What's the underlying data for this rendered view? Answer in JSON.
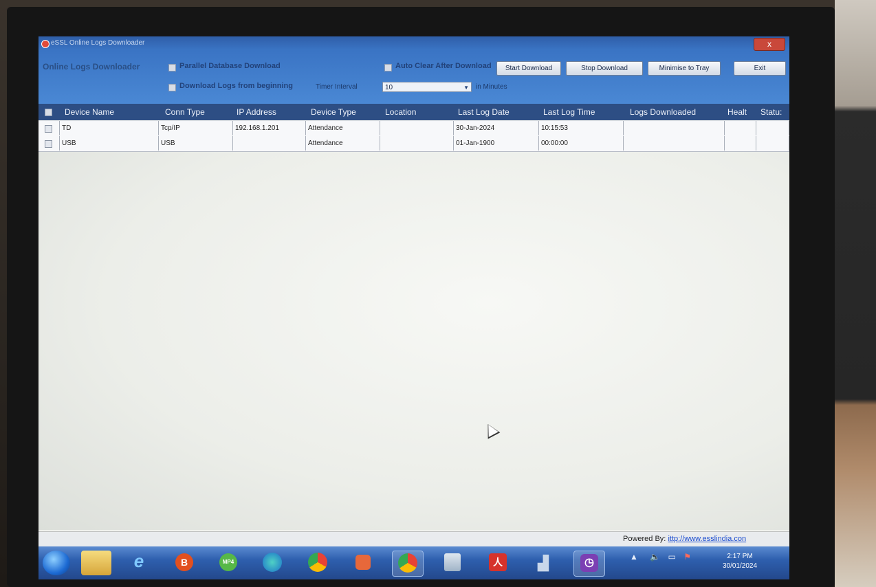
{
  "window": {
    "title": "eSSL Online Logs Downloader",
    "close_label": "x"
  },
  "toolbar": {
    "app_name": "Online Logs Downloader",
    "parallel_db_label": "Parallel Database Download",
    "download_beginning_label": "Download Logs from beginning",
    "auto_clear_label": "Auto Clear After Download",
    "timer_interval_label": "Timer Interval",
    "timer_interval_value": "10",
    "in_minutes_label": "in Minutes",
    "start_download_label": "Start Download",
    "stop_download_label": "Stop Download",
    "minimise_label": "Minimise to Tray",
    "exit_label": "Exit"
  },
  "grid": {
    "columns": [
      "Device Name",
      "Conn Type",
      "IP Address",
      "Device Type",
      "Location",
      "Last Log Date",
      "Last Log Time",
      "Logs Downloaded",
      "Healt",
      "Statu:"
    ],
    "rows": [
      {
        "device_name": "TD",
        "conn_type": "Tcp/IP",
        "ip": "192.168.1.201",
        "device_type": "Attendance",
        "location": "",
        "last_log_date": "30-Jan-2024",
        "last_log_time": "10:15:53",
        "logs_downloaded": "",
        "health": "",
        "status": ""
      },
      {
        "device_name": "USB",
        "conn_type": "USB",
        "ip": "",
        "device_type": "Attendance",
        "location": "",
        "last_log_date": "01-Jan-1900",
        "last_log_time": "00:00:00",
        "logs_downloaded": "",
        "health": "",
        "status": ""
      }
    ]
  },
  "footer": {
    "powered_by": "Powered By:",
    "link": "ittp://www.esslindia.con"
  },
  "taskbar": {
    "time": "2:17 PM",
    "date": "30/01/2024",
    "icons": [
      "start-orb-icon",
      "file-explorer-icon",
      "internet-explorer-icon",
      "b-app-icon",
      "mp4-converter-icon",
      "edge-icon",
      "chrome-icon",
      "media-app-icon",
      "chrome-active-icon",
      "scanner-icon",
      "acrobat-icon",
      "chart-app-icon",
      "timewatch-icon"
    ]
  },
  "colors": {
    "titlebar": "#3a74c4",
    "header": "#2d4e84",
    "taskbar": "#2e5fae"
  }
}
